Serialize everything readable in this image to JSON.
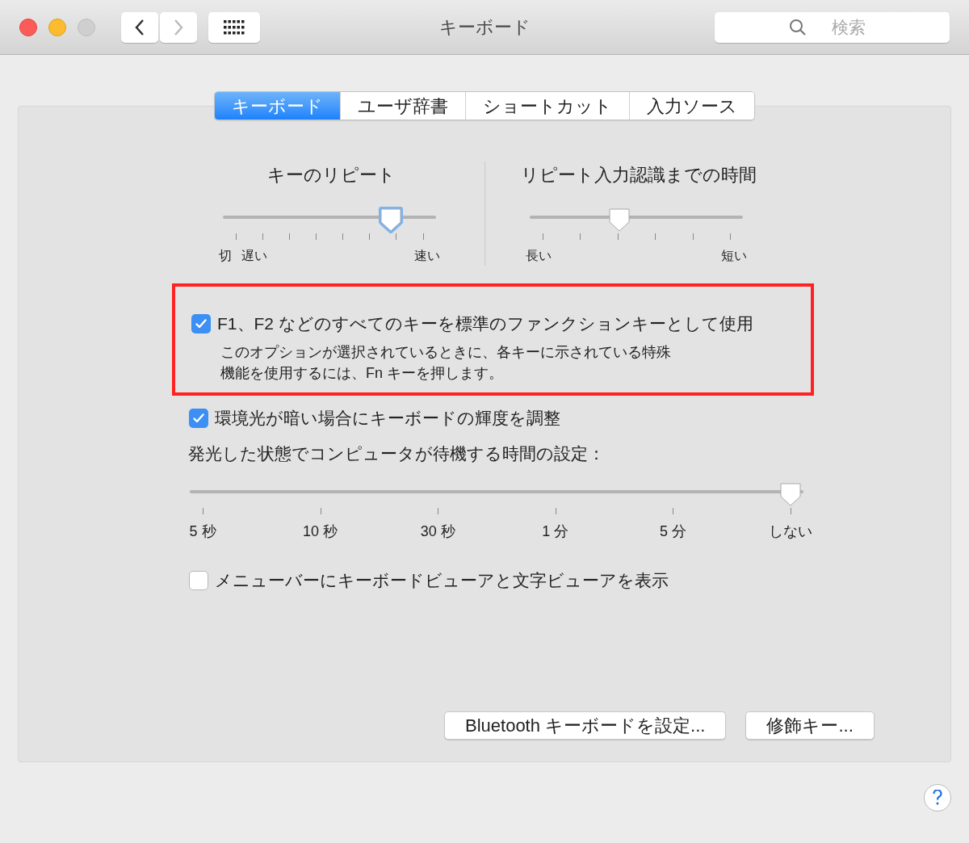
{
  "window": {
    "title": "キーボード"
  },
  "search": {
    "placeholder": "検索"
  },
  "tabs": [
    {
      "label": "キーボード",
      "selected": true
    },
    {
      "label": "ユーザ辞書",
      "selected": false
    },
    {
      "label": "ショートカット",
      "selected": false
    },
    {
      "label": "入力ソース",
      "selected": false
    }
  ],
  "repeat_sliders": [
    {
      "title": "キーのリピート",
      "level": 0.83,
      "focused": true,
      "labels": [
        "切",
        "遅い",
        "速い"
      ]
    },
    {
      "title": "リピート入力認識までの時間",
      "level": 0.41,
      "focused": false,
      "labels": [
        "長い",
        "短い"
      ]
    }
  ],
  "function_keys_option": {
    "label": "F1、F2 などのすべてのキーを標準のファンクションキーとして使用",
    "checked": true,
    "highlighted": true,
    "description": [
      "このオプションが選択されているときに、各キーに示されている特殊",
      "機能を使用するには、Fn キーを押します。"
    ]
  },
  "brightness_option": {
    "label": "環境光が暗い場合にキーボードの輝度を調整",
    "checked": true
  },
  "backlight": {
    "label": "発光した状態でコンピュータが待機する時間の設定：",
    "level": 1,
    "focused": false,
    "labels": [
      "5 秒",
      "10 秒",
      "30 秒",
      "1 分",
      "5 分",
      "しない"
    ]
  },
  "viewer_option": {
    "label": "メニューバーにキーボードビューアと文字ビューアを表示",
    "checked": false
  },
  "buttons": [
    "Bluetooth キーボードを設定...",
    "修飾キー..."
  ]
}
